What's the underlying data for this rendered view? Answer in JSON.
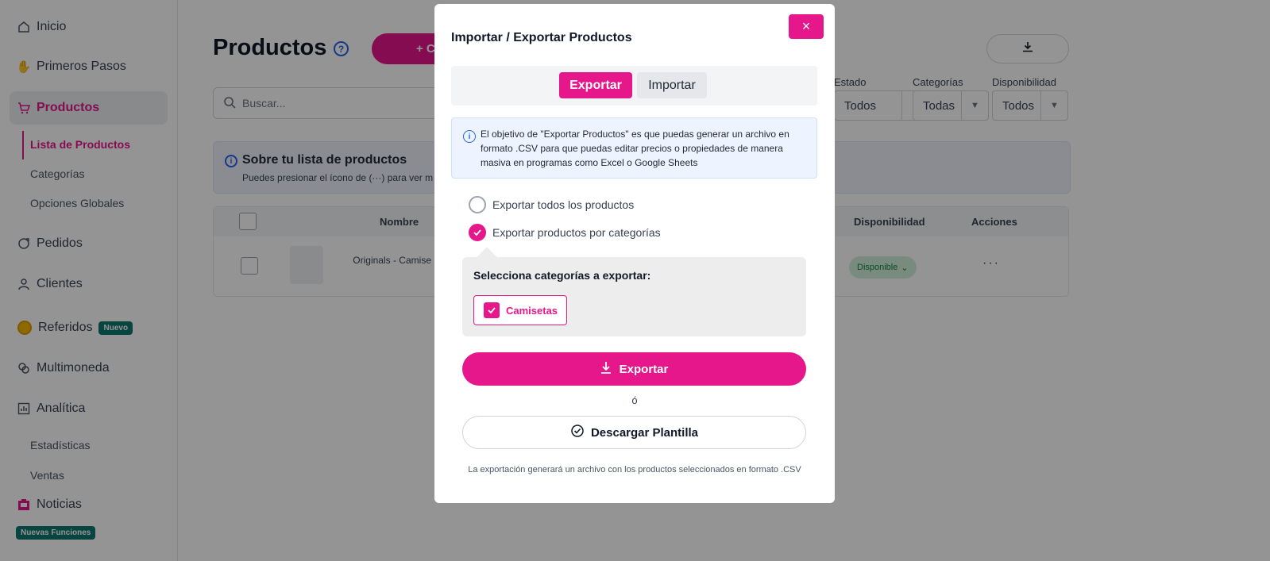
{
  "sidebar": {
    "items": [
      {
        "label": "Inicio",
        "icon": "home-icon"
      },
      {
        "label": "Primeros Pasos",
        "icon": "hand-icon"
      },
      {
        "label": "Productos",
        "icon": "cart-icon"
      },
      {
        "label": "Pedidos",
        "icon": "orders-icon"
      },
      {
        "label": "Clientes",
        "icon": "user-icon"
      },
      {
        "label": "Referidos",
        "icon": "coin-icon",
        "badge": "Nuevo"
      },
      {
        "label": "Multimoneda",
        "icon": "currency-icon"
      },
      {
        "label": "Analítica",
        "icon": "chart-icon"
      },
      {
        "label": "Noticias",
        "icon": "news-icon",
        "badge": "Nuevas Funciones"
      }
    ],
    "productos_sub": [
      "Lista de Productos",
      "Categorías",
      "Opciones Globales"
    ],
    "analitica_sub": [
      "Estadísticas",
      "Ventas"
    ]
  },
  "main": {
    "title": "Productos",
    "new_button": "+ C",
    "search_placeholder": "Buscar...",
    "filters": [
      {
        "label": "Estado",
        "value": "Todos"
      },
      {
        "label": "Categorías",
        "value": "Todas"
      },
      {
        "label": "Disponibilidad",
        "value": "Todos"
      }
    ],
    "info": {
      "title": "Sobre tu lista de productos",
      "text": "Puedes presionar el ícono de (···) para ver m"
    },
    "table": {
      "headers": {
        "name": "Nombre",
        "availability": "Disponibilidad",
        "actions": "Acciones"
      },
      "rows": [
        {
          "name": "Originals - Camise Rubius",
          "availability": "Disponible",
          "actions": "···"
        }
      ]
    }
  },
  "modal": {
    "title": "Importar / Exportar Productos",
    "close": "×",
    "tabs": {
      "export": "Exportar",
      "import": "Importar"
    },
    "notice": "El objetivo de \"Exportar Productos\" es que puedas generar un archivo en formato .CSV para que puedas editar precios o propiedades de manera masiva en programas como Excel o Google Sheets",
    "options": {
      "all": "Exportar todos los productos",
      "by_category": "Exportar productos por categorías"
    },
    "selected_option": "by_category",
    "categories_title": "Selecciona categorías a exportar:",
    "categories": [
      {
        "name": "Camisetas",
        "checked": true
      }
    ],
    "export_button": "Exportar",
    "or": "ó",
    "template_button": "Descargar Plantilla",
    "footnote": "La exportación generará un archivo con los productos seleccionados en formato .CSV"
  },
  "colors": {
    "accent": "#e6168b",
    "info": "#2563eb",
    "available": "#15803d"
  }
}
